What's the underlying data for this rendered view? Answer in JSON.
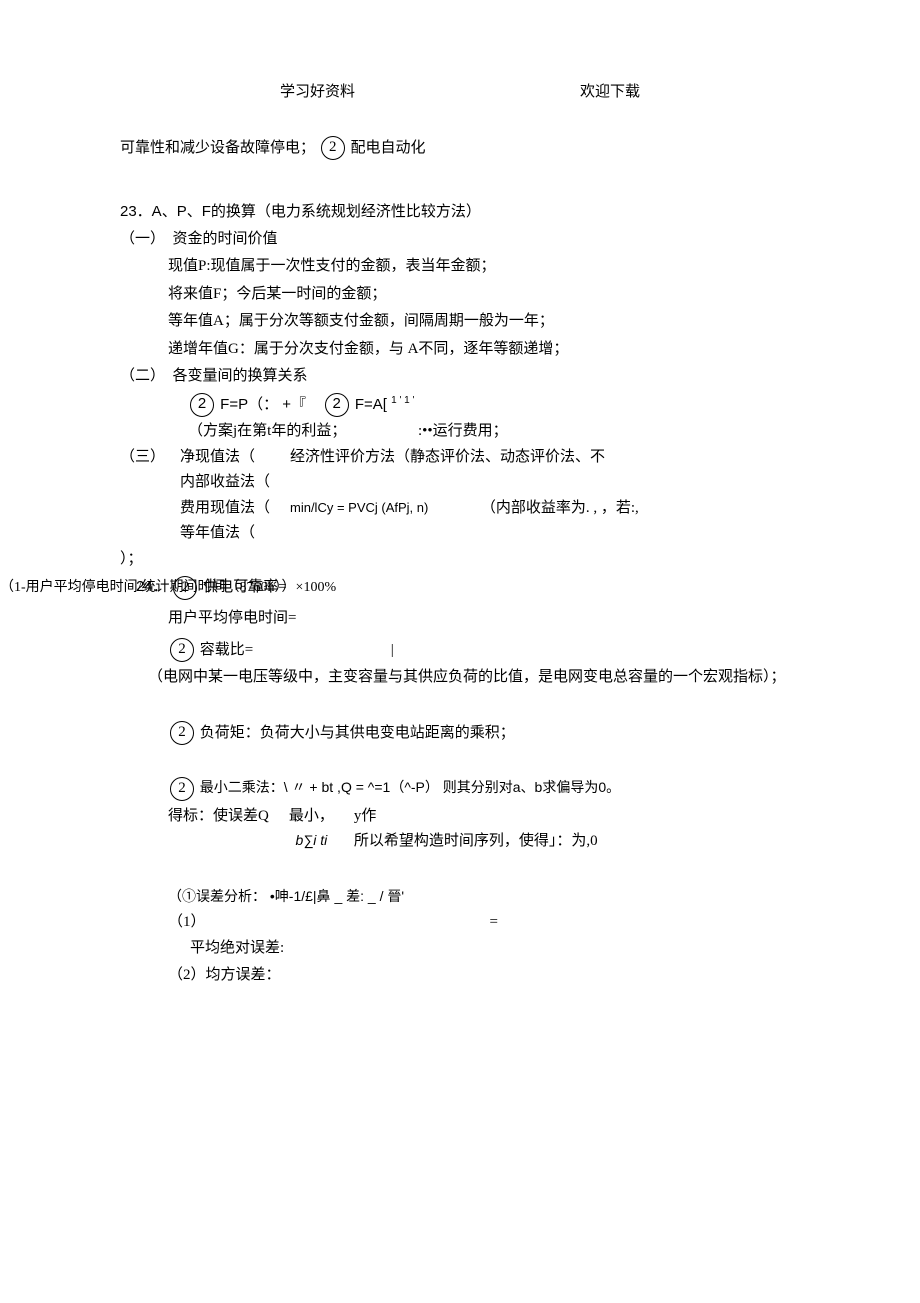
{
  "header": {
    "left": "学习好资料",
    "right": "欢迎下载"
  },
  "line_top": {
    "prefix": "可靠性和减少设备故障停电；",
    "circled": "2",
    "suffix": "配电自动化"
  },
  "s23": {
    "title": "23．A、P、F的换算（电力系统规划经济性比较方法）",
    "p1_head": "（一）　资金的时间价值",
    "p1_a": "现值P:现值属于一次性支付的金额，表当年金额；",
    "p1_b": "将来值F；今后某一时间的金额；",
    "p1_c": "等年值A；属于分次等额支付金额，间隔周期一般为一年；",
    "p1_d": "递增年值G：属于分次支付金额，与 A不同，逐年等额递增；",
    "p2_head": "（二）　各变量间的换算关系",
    "p2_row": {
      "c1": "2",
      "f1": "F=P（： +『",
      "c2": "2",
      "f2": "F=A[",
      "sup": "1     '     1 '"
    },
    "p2_sub_a": "（方案j在第t年的利益；",
    "p2_sub_b": ":••运行费用；",
    "p3_head": "（三）",
    "p3_a": "净现值法（",
    "p3_a_r": "经济性评价方法（静态评价法、动态评价法、不",
    "p3_b": "内部收益法（",
    "p3_c": "费用现值法（",
    "p3_c_mid": "min/lCy = PVCj (AfPj, n)",
    "p3_c_right": "（内部收益率为. , ，若:,",
    "p3_d": "等年值法（",
    "p3_close": "）；"
  },
  "s24": {
    "overflow": "（1-用户平均停电时间/统计期间时间（8760h））×100%",
    "title_pre": "24．",
    "circ": "2",
    "title_post": "供电可靠率=",
    "row2": "用户平均停电时间=",
    "row3": {
      "circ": "2",
      "text": "容载比=",
      "right": "|"
    },
    "row3_note": "（电网中某一电压等级中，主变容量与其供应负荷的比值，是电网变电总容量的一个宏观指标）；",
    "row4": {
      "circ": "2",
      "text": "负荷矩：负荷大小与其供电变电站距离的乘积；"
    },
    "row5": {
      "circ": "2",
      "text": "最小二乘法：\\     〃  + bt ,Q = ^=1（^-P） 则其分别对a、b求偏导为0。"
    },
    "row5b_left": "得标：使误差Q",
    "row5b_mid": "最小，",
    "row5b_frac": "b∑i ti",
    "row5b_y": "y作",
    "row5b_right": "所以希望构造时间序列，使得」：为,0",
    "err_head": "（①误差分析：    •呻-1/£|鼻 _ 差: _ / 晉'",
    "err_1": "（1）",
    "err_1_eq": "=",
    "err_1_label": "平均绝对误差:",
    "err_2": "（2）均方误差："
  }
}
